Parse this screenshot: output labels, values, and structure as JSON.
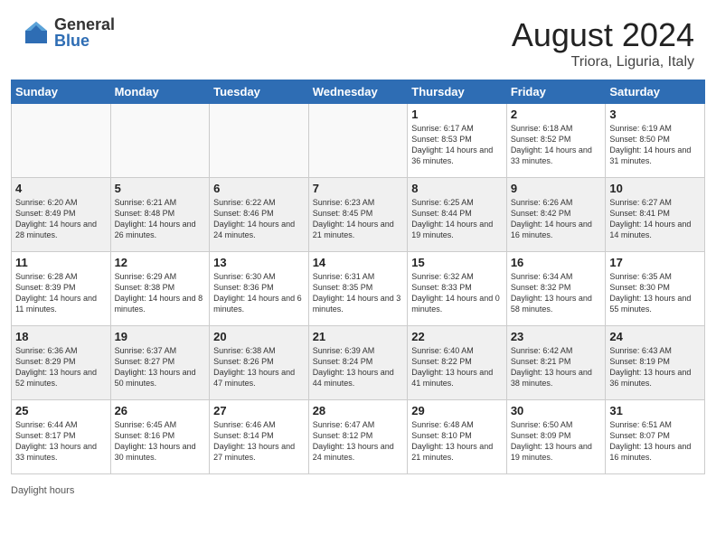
{
  "header": {
    "logo_general": "General",
    "logo_blue": "Blue",
    "month_title": "August 2024",
    "location": "Triora, Liguria, Italy"
  },
  "days_of_week": [
    "Sunday",
    "Monday",
    "Tuesday",
    "Wednesday",
    "Thursday",
    "Friday",
    "Saturday"
  ],
  "weeks": [
    [
      {
        "day": "",
        "info": ""
      },
      {
        "day": "",
        "info": ""
      },
      {
        "day": "",
        "info": ""
      },
      {
        "day": "",
        "info": ""
      },
      {
        "day": "1",
        "info": "Sunrise: 6:17 AM\nSunset: 8:53 PM\nDaylight: 14 hours\nand 36 minutes."
      },
      {
        "day": "2",
        "info": "Sunrise: 6:18 AM\nSunset: 8:52 PM\nDaylight: 14 hours\nand 33 minutes."
      },
      {
        "day": "3",
        "info": "Sunrise: 6:19 AM\nSunset: 8:50 PM\nDaylight: 14 hours\nand 31 minutes."
      }
    ],
    [
      {
        "day": "4",
        "info": "Sunrise: 6:20 AM\nSunset: 8:49 PM\nDaylight: 14 hours\nand 28 minutes."
      },
      {
        "day": "5",
        "info": "Sunrise: 6:21 AM\nSunset: 8:48 PM\nDaylight: 14 hours\nand 26 minutes."
      },
      {
        "day": "6",
        "info": "Sunrise: 6:22 AM\nSunset: 8:46 PM\nDaylight: 14 hours\nand 24 minutes."
      },
      {
        "day": "7",
        "info": "Sunrise: 6:23 AM\nSunset: 8:45 PM\nDaylight: 14 hours\nand 21 minutes."
      },
      {
        "day": "8",
        "info": "Sunrise: 6:25 AM\nSunset: 8:44 PM\nDaylight: 14 hours\nand 19 minutes."
      },
      {
        "day": "9",
        "info": "Sunrise: 6:26 AM\nSunset: 8:42 PM\nDaylight: 14 hours\nand 16 minutes."
      },
      {
        "day": "10",
        "info": "Sunrise: 6:27 AM\nSunset: 8:41 PM\nDaylight: 14 hours\nand 14 minutes."
      }
    ],
    [
      {
        "day": "11",
        "info": "Sunrise: 6:28 AM\nSunset: 8:39 PM\nDaylight: 14 hours\nand 11 minutes."
      },
      {
        "day": "12",
        "info": "Sunrise: 6:29 AM\nSunset: 8:38 PM\nDaylight: 14 hours\nand 8 minutes."
      },
      {
        "day": "13",
        "info": "Sunrise: 6:30 AM\nSunset: 8:36 PM\nDaylight: 14 hours\nand 6 minutes."
      },
      {
        "day": "14",
        "info": "Sunrise: 6:31 AM\nSunset: 8:35 PM\nDaylight: 14 hours\nand 3 minutes."
      },
      {
        "day": "15",
        "info": "Sunrise: 6:32 AM\nSunset: 8:33 PM\nDaylight: 14 hours\nand 0 minutes."
      },
      {
        "day": "16",
        "info": "Sunrise: 6:34 AM\nSunset: 8:32 PM\nDaylight: 13 hours\nand 58 minutes."
      },
      {
        "day": "17",
        "info": "Sunrise: 6:35 AM\nSunset: 8:30 PM\nDaylight: 13 hours\nand 55 minutes."
      }
    ],
    [
      {
        "day": "18",
        "info": "Sunrise: 6:36 AM\nSunset: 8:29 PM\nDaylight: 13 hours\nand 52 minutes."
      },
      {
        "day": "19",
        "info": "Sunrise: 6:37 AM\nSunset: 8:27 PM\nDaylight: 13 hours\nand 50 minutes."
      },
      {
        "day": "20",
        "info": "Sunrise: 6:38 AM\nSunset: 8:26 PM\nDaylight: 13 hours\nand 47 minutes."
      },
      {
        "day": "21",
        "info": "Sunrise: 6:39 AM\nSunset: 8:24 PM\nDaylight: 13 hours\nand 44 minutes."
      },
      {
        "day": "22",
        "info": "Sunrise: 6:40 AM\nSunset: 8:22 PM\nDaylight: 13 hours\nand 41 minutes."
      },
      {
        "day": "23",
        "info": "Sunrise: 6:42 AM\nSunset: 8:21 PM\nDaylight: 13 hours\nand 38 minutes."
      },
      {
        "day": "24",
        "info": "Sunrise: 6:43 AM\nSunset: 8:19 PM\nDaylight: 13 hours\nand 36 minutes."
      }
    ],
    [
      {
        "day": "25",
        "info": "Sunrise: 6:44 AM\nSunset: 8:17 PM\nDaylight: 13 hours\nand 33 minutes."
      },
      {
        "day": "26",
        "info": "Sunrise: 6:45 AM\nSunset: 8:16 PM\nDaylight: 13 hours\nand 30 minutes."
      },
      {
        "day": "27",
        "info": "Sunrise: 6:46 AM\nSunset: 8:14 PM\nDaylight: 13 hours\nand 27 minutes."
      },
      {
        "day": "28",
        "info": "Sunrise: 6:47 AM\nSunset: 8:12 PM\nDaylight: 13 hours\nand 24 minutes."
      },
      {
        "day": "29",
        "info": "Sunrise: 6:48 AM\nSunset: 8:10 PM\nDaylight: 13 hours\nand 21 minutes."
      },
      {
        "day": "30",
        "info": "Sunrise: 6:50 AM\nSunset: 8:09 PM\nDaylight: 13 hours\nand 19 minutes."
      },
      {
        "day": "31",
        "info": "Sunrise: 6:51 AM\nSunset: 8:07 PM\nDaylight: 13 hours\nand 16 minutes."
      }
    ]
  ],
  "footer": {
    "note": "Daylight hours"
  },
  "colors": {
    "header_bg": "#2e6db4",
    "header_text": "#ffffff",
    "shaded_row_bg": "#f0f0f0",
    "normal_row_bg": "#ffffff"
  }
}
